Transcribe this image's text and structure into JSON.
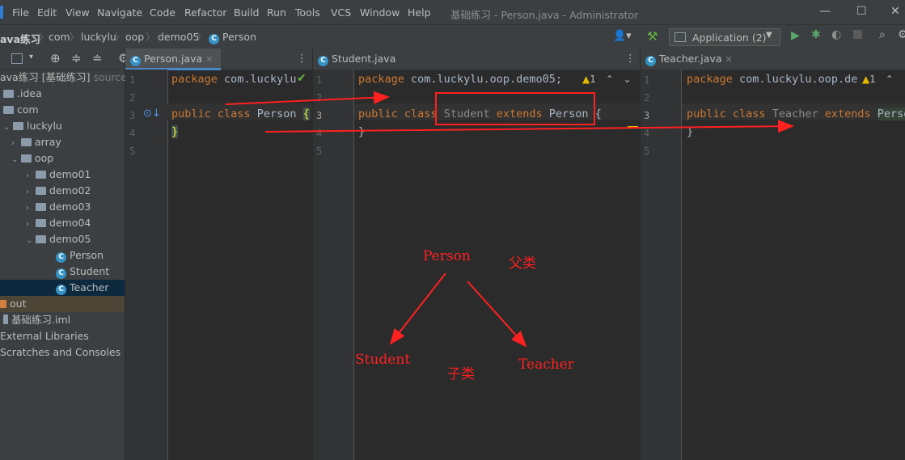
{
  "menubar": {
    "items": [
      "File",
      "Edit",
      "View",
      "Navigate",
      "Code",
      "Refactor",
      "Build",
      "Run",
      "Tools",
      "VCS",
      "Window",
      "Help"
    ],
    "window_title": "基础练习 - Person.java - Administrator"
  },
  "navbar": {
    "breadcrumb": [
      "ava练习",
      "com",
      "luckylu",
      "oop",
      "demo05",
      "Person"
    ],
    "run_config": "Application (2)"
  },
  "project": {
    "root": "ava练习 [基础练习]",
    "root_suffix": "source",
    "items": [
      ".idea",
      "com",
      "luckylu",
      "array",
      "oop",
      "demo01",
      "demo02",
      "demo03",
      "demo04",
      "demo05",
      "Person",
      "Student",
      "Teacher",
      "out",
      "基础练习.iml",
      "External Libraries",
      "Scratches and Consoles"
    ]
  },
  "editors": [
    {
      "tab": "Person.java",
      "lines": [
        "1",
        "2",
        "3",
        "4",
        "5"
      ],
      "code": {
        "package": "package",
        "pkg_name": "com.luckylu",
        "public": "public",
        "class": "class",
        "name": "Person",
        "brace_open": "{",
        "brace_close": "}"
      }
    },
    {
      "tab": "Student.java",
      "lines": [
        "1",
        "2",
        "3",
        "4",
        "5"
      ],
      "warn_count": "1",
      "code": {
        "package": "package",
        "pkg_name": "com.luckylu.oop.demo05;",
        "public": "public",
        "class": "class",
        "name": "Student",
        "extends": "extends",
        "parent": "Person",
        "brace_open": "{",
        "brace_close": "}"
      }
    },
    {
      "tab": "Teacher.java",
      "lines": [
        "1",
        "2",
        "3",
        "4",
        "5"
      ],
      "warn_count": "1",
      "code": {
        "package": "package",
        "pkg_name": "com.luckylu.oop.de",
        "public": "public",
        "class": "class",
        "name": "Teacher",
        "extends": "extends",
        "parent": "Perso",
        "brace_close": "}"
      }
    }
  ],
  "annotations": {
    "parent": "Person",
    "parent_label": "父类",
    "child1": "Student",
    "child2": "Teacher",
    "child_label": "子类"
  },
  "colors": {
    "accent": "#4a88c7",
    "annotation": "#ff2020",
    "keyword": "#cc7832"
  }
}
